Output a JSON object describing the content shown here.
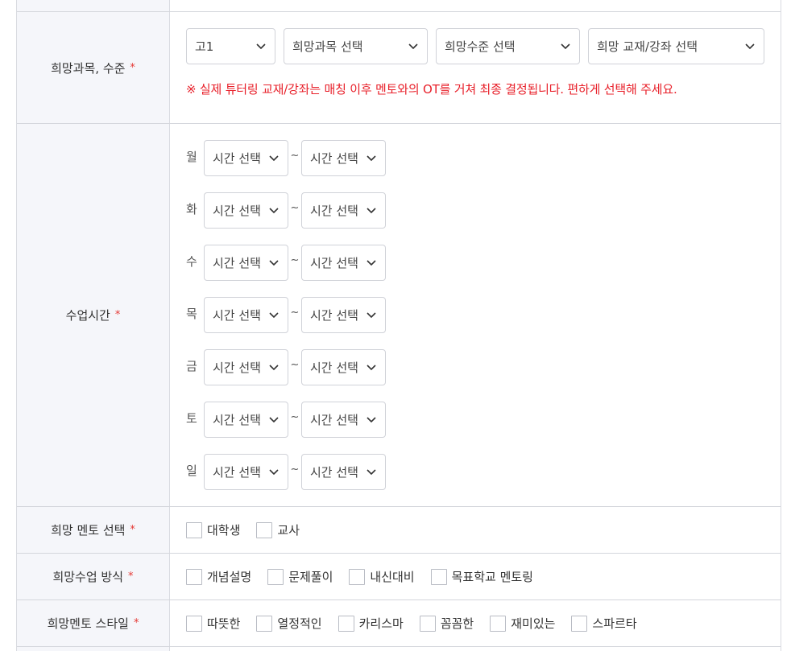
{
  "subject": {
    "label": "희망과목, 수준",
    "required_mark": "*",
    "grade_select": "고1",
    "subject_select": "희망과목 선택",
    "level_select": "희망수준 선택",
    "material_select": "희망 교재/강좌 선택",
    "notice": "※ 실제 튜터링 교재/강좌는 매칭 이후 멘토와의 OT를 거쳐 최종 결정됩니다. 편하게 선택해 주세요."
  },
  "schedule": {
    "label": "수업시간",
    "required_mark": "*",
    "separator": "~",
    "days": [
      {
        "day": "월",
        "start": "시간 선택",
        "end": "시간 선택"
      },
      {
        "day": "화",
        "start": "시간 선택",
        "end": "시간 선택"
      },
      {
        "day": "수",
        "start": "시간 선택",
        "end": "시간 선택"
      },
      {
        "day": "목",
        "start": "시간 선택",
        "end": "시간 선택"
      },
      {
        "day": "금",
        "start": "시간 선택",
        "end": "시간 선택"
      },
      {
        "day": "토",
        "start": "시간 선택",
        "end": "시간 선택"
      },
      {
        "day": "일",
        "start": "시간 선택",
        "end": "시간 선택"
      }
    ]
  },
  "mentor_type": {
    "label": "희망 멘토 선택",
    "required_mark": "*",
    "options": [
      "대학생",
      "교사"
    ]
  },
  "class_method": {
    "label": "희망수업 방식",
    "required_mark": "*",
    "options": [
      "개념설명",
      "문제풀이",
      "내신대비",
      "목표학교 멘토링"
    ]
  },
  "mentor_style": {
    "label": "희망멘토 스타일",
    "required_mark": "*",
    "options": [
      "따뜻한",
      "열정적인",
      "카리스마",
      "꼼꼼한",
      "재미있는",
      "스파르타"
    ]
  },
  "colors": {
    "required": "#e53935",
    "notice": "#e8202a",
    "header_bg": "#f5f6fa",
    "border": "#d9dbe1"
  }
}
